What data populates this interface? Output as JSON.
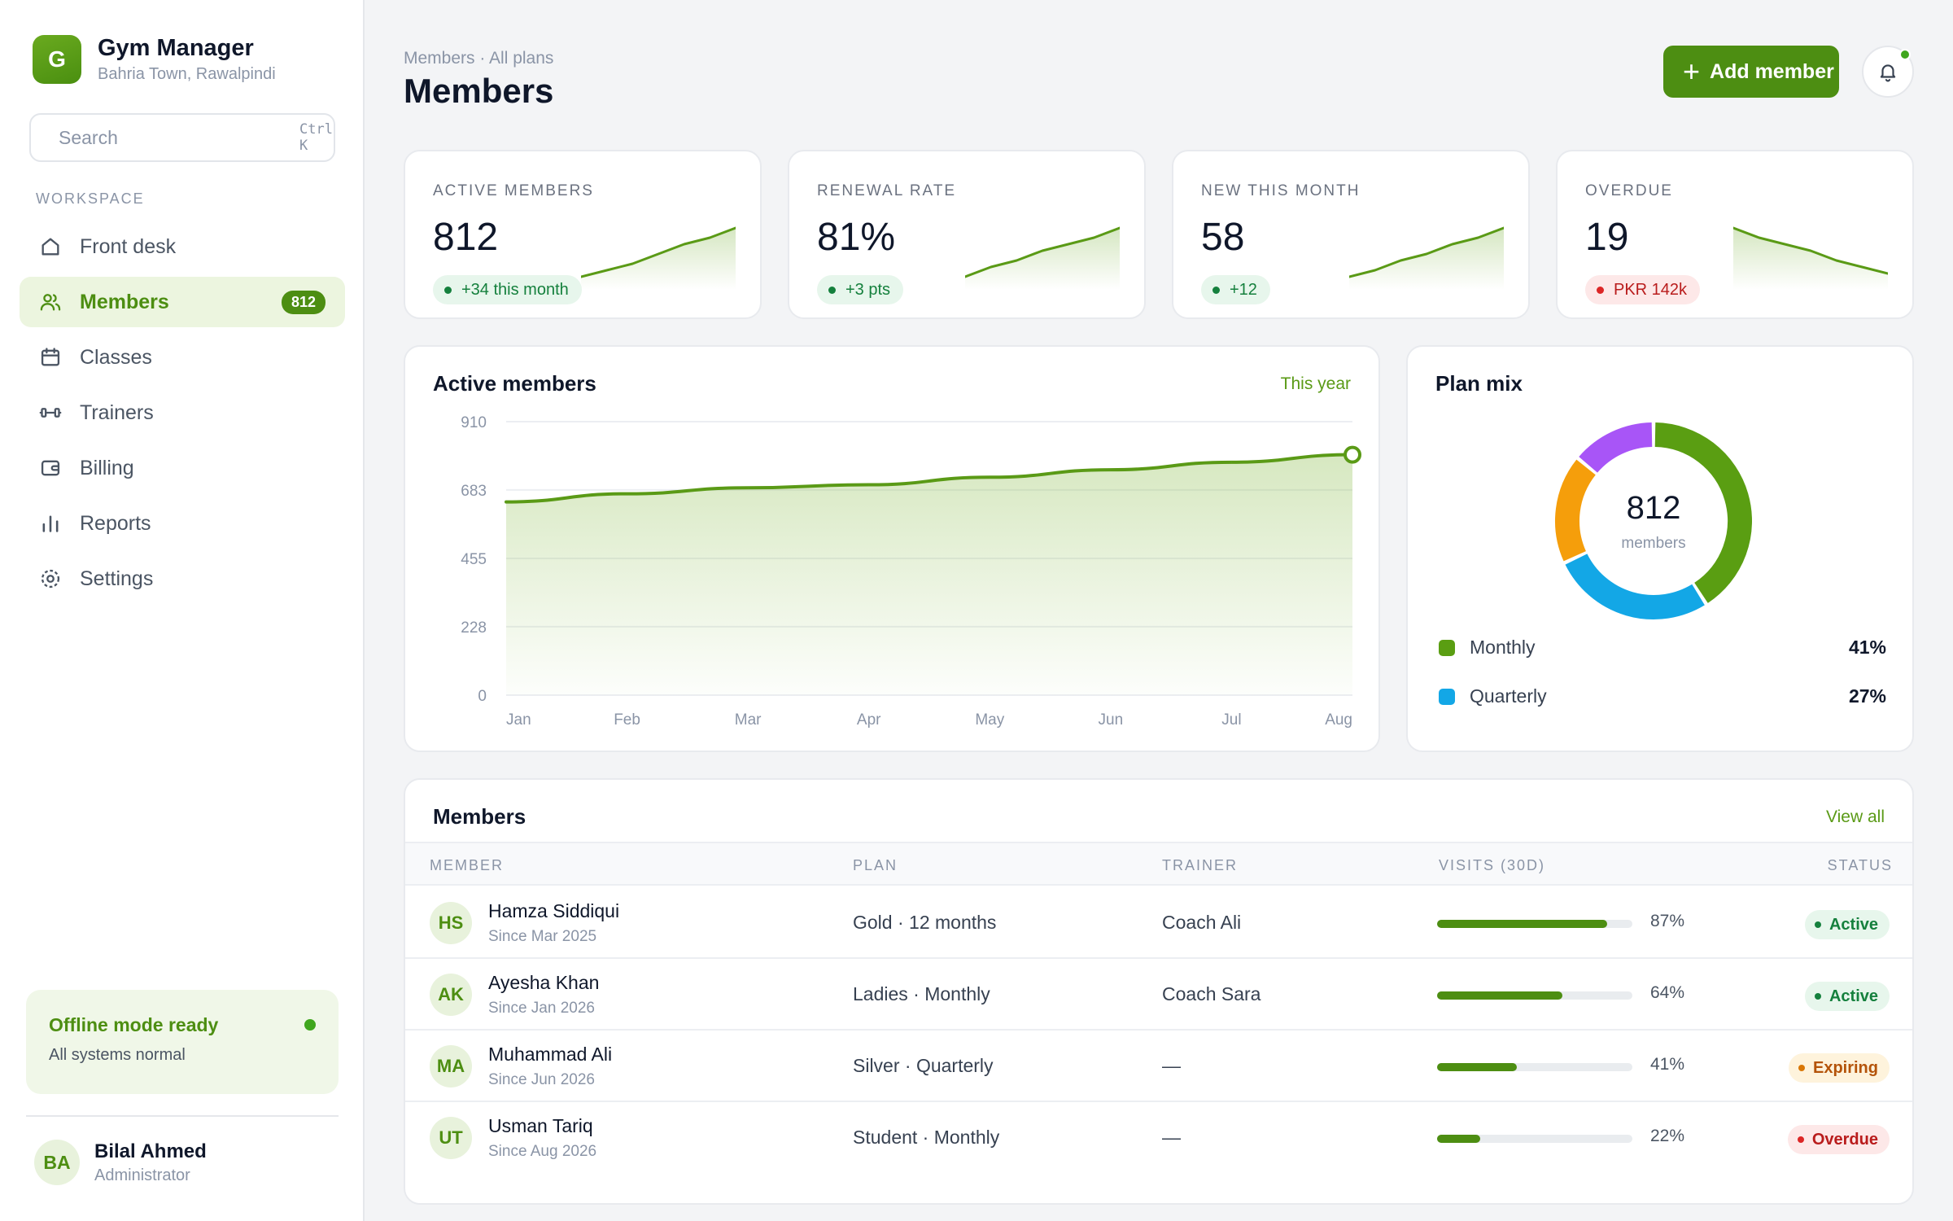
{
  "brand": {
    "logo_letter": "G",
    "name": "Gym Manager",
    "location": "Bahria Town, Rawalpindi"
  },
  "search": {
    "placeholder": "Search",
    "shortcut": "Ctrl K"
  },
  "sidebar": {
    "section_label": "WORKSPACE",
    "items": [
      {
        "label": "Front desk",
        "icon": "home-icon"
      },
      {
        "label": "Members",
        "icon": "users-icon",
        "badge": "812",
        "active": true
      },
      {
        "label": "Classes",
        "icon": "calendar-icon"
      },
      {
        "label": "Trainers",
        "icon": "dumbbell-icon"
      },
      {
        "label": "Billing",
        "icon": "wallet-icon"
      },
      {
        "label": "Reports",
        "icon": "bar-chart-icon"
      },
      {
        "label": "Settings",
        "icon": "gear-icon"
      }
    ],
    "offline": {
      "title": "Offline mode ready",
      "subtitle": "All systems normal"
    },
    "user": {
      "initials": "BA",
      "name": "Bilal Ahmed",
      "role": "Administrator"
    }
  },
  "header": {
    "breadcrumb": "Members · All plans",
    "title": "Members",
    "add_button": "Add member"
  },
  "kpis": [
    {
      "label": "ACTIVE MEMBERS",
      "value": "812",
      "pill": "+34 this month",
      "tone": "green",
      "trend": [
        2,
        3,
        4,
        5.5,
        7,
        8,
        9.5
      ]
    },
    {
      "label": "RENEWAL RATE",
      "value": "81%",
      "pill": "+3 pts",
      "tone": "green",
      "trend": [
        2,
        3.5,
        4.5,
        6,
        7,
        8,
        9.5
      ]
    },
    {
      "label": "NEW THIS MONTH",
      "value": "58",
      "pill": "+12",
      "tone": "green",
      "trend": [
        2,
        3,
        4.5,
        5.5,
        7,
        8,
        9.5
      ]
    },
    {
      "label": "OVERDUE",
      "value": "19",
      "pill": "PKR 142k",
      "tone": "red",
      "trend": [
        9.5,
        8,
        7,
        6,
        4.5,
        3.5,
        2.5
      ]
    }
  ],
  "active_chart": {
    "title": "Active members",
    "range_link": "This year"
  },
  "chart_data": {
    "type": "area",
    "categories": [
      "Jan",
      "Feb",
      "Mar",
      "Apr",
      "May",
      "Jun",
      "Jul",
      "Aug"
    ],
    "values": [
      643,
      670,
      690,
      700,
      725,
      750,
      775,
      800
    ],
    "yticks": [
      0,
      228,
      455,
      683,
      910
    ],
    "ylim": [
      0,
      910
    ],
    "grid": true
  },
  "plan_mix": {
    "title": "Plan mix",
    "total": "812",
    "total_label": "members",
    "segments": [
      {
        "name": "Monthly",
        "pct": 41,
        "pct_label": "41%",
        "color": "#5a9e12"
      },
      {
        "name": "Quarterly",
        "pct": 27,
        "pct_label": "27%",
        "color": "#13a7e6"
      },
      {
        "name": "",
        "pct": 18,
        "color": "#f59e0b"
      },
      {
        "name": "",
        "pct": 14,
        "color": "#a855f7"
      }
    ]
  },
  "members_table": {
    "title": "Members",
    "view_all": "View all",
    "columns": [
      "MEMBER",
      "PLAN",
      "TRAINER",
      "VISITS (30D)",
      "STATUS"
    ],
    "rows": [
      {
        "initials": "HS",
        "name": "Hamza Siddiqui",
        "since": "Since Mar 2025",
        "plan": "Gold · 12 months",
        "trainer": "Coach Ali",
        "visits_pct": 87,
        "visits": "87%",
        "status": "Active",
        "status_tone": "active"
      },
      {
        "initials": "AK",
        "name": "Ayesha Khan",
        "since": "Since Jan 2026",
        "plan": "Ladies · Monthly",
        "trainer": "Coach Sara",
        "visits_pct": 64,
        "visits": "64%",
        "status": "Active",
        "status_tone": "active"
      },
      {
        "initials": "MA",
        "name": "Muhammad Ali",
        "since": "Since Jun 2026",
        "plan": "Silver · Quarterly",
        "trainer": "—",
        "visits_pct": 41,
        "visits": "41%",
        "status": "Expiring",
        "status_tone": "expiring"
      },
      {
        "initials": "UT",
        "name": "Usman Tariq",
        "since": "Since Aug 2026",
        "plan": "Student · Monthly",
        "trainer": "—",
        "visits_pct": 22,
        "visits": "22%",
        "status": "Overdue",
        "status_tone": "overdue"
      }
    ]
  },
  "colors": {
    "accent": "#4d8e12",
    "accent_soft": "#ecf5df",
    "background": "#f3f4f6"
  }
}
